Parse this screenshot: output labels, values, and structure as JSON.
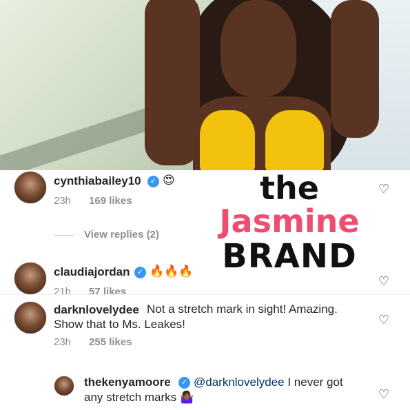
{
  "comments": [
    {
      "username": "cynthiabailey10",
      "verified": true,
      "text": "😍",
      "time": "23h",
      "likes": "169 likes"
    },
    {
      "username": "claudiajordan",
      "verified": true,
      "text": "🔥🔥🔥",
      "time": "21h",
      "likes": "57 likes"
    },
    {
      "username": "darknlovelydee",
      "verified": false,
      "text_line1": "Not a stretch mark in sight! Amazing.",
      "text_line2": "Show that to Ms. Leakes!",
      "time": "23h",
      "likes": "255 likes"
    },
    {
      "username": "thekenyamoore",
      "verified": true,
      "mention": "@darknlovelydee",
      "text_after_mention": "I never got",
      "text_line2": "any stretch marks 🤷🏾‍♀️"
    }
  ],
  "view_replies": "View replies (2)",
  "icons": {
    "verified": "verified-badge-icon",
    "like": "heart-outline-icon"
  },
  "watermark": {
    "line1": "the",
    "line2": "Jasmine",
    "line3": "BRAND"
  },
  "colors": {
    "verified": "#3897f0",
    "meta": "#8e8e8e",
    "brand_pink": "#ef4d6f"
  }
}
